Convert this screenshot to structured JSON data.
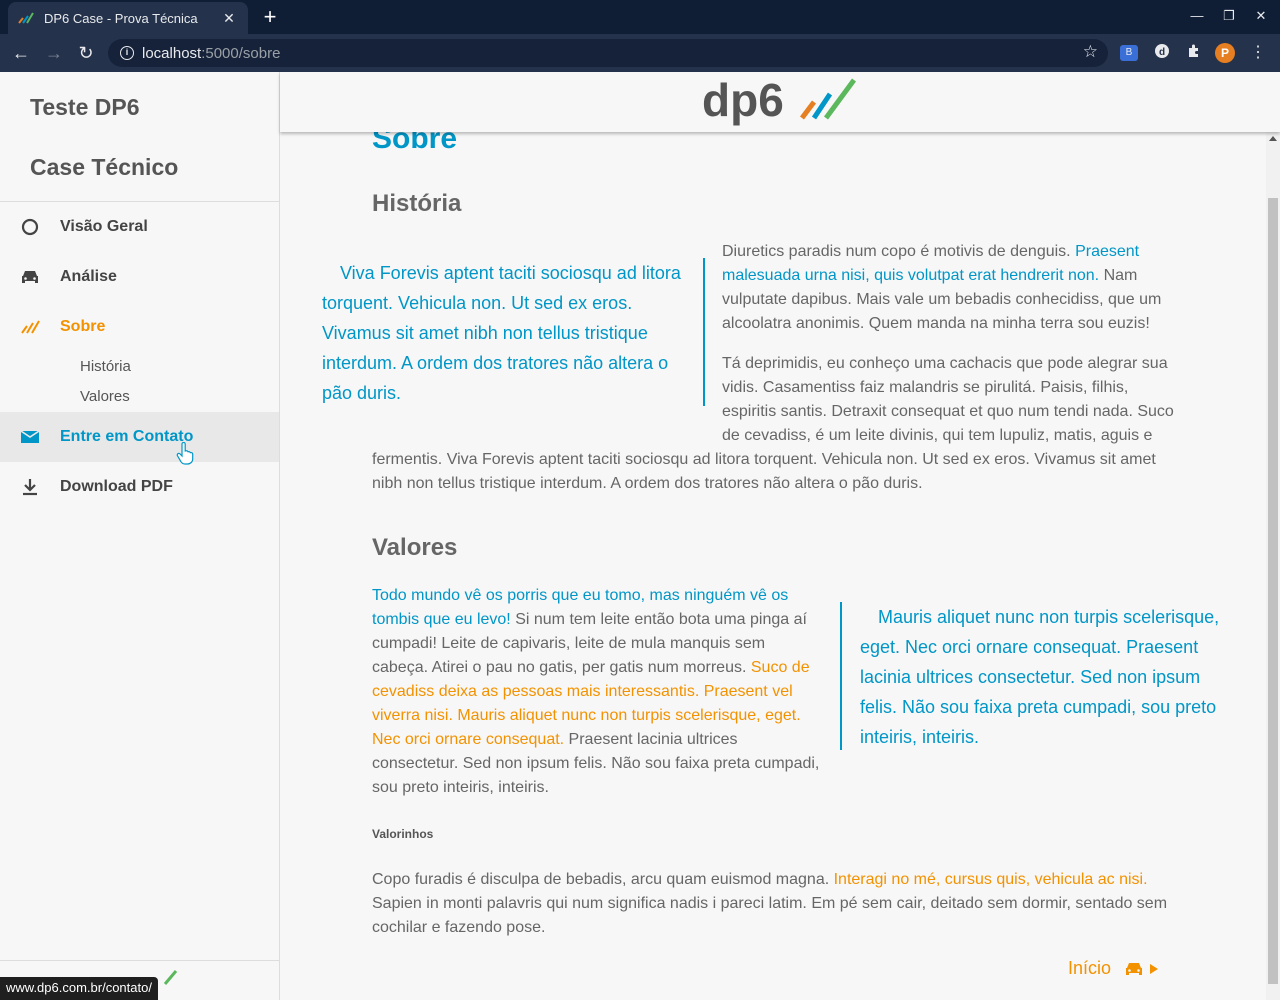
{
  "browser": {
    "tab_title": "DP6 Case - Prova Técnica",
    "url_host": "localhost",
    "url_path": ":5000/sobre",
    "profile_initial": "P",
    "status_url": "www.dp6.com.br/contato/"
  },
  "sidebar": {
    "brand_line1": "Teste DP6",
    "brand_line2": "Case Técnico",
    "items": [
      {
        "label": "Visão Geral",
        "icon": "circle-icon"
      },
      {
        "label": "Análise",
        "icon": "car-icon"
      },
      {
        "label": "Sobre",
        "icon": "dp6-bars-icon"
      },
      {
        "label": "Entre em Contato",
        "icon": "mail-icon"
      },
      {
        "label": "Download PDF",
        "icon": "download-icon"
      }
    ],
    "subitems": [
      "História",
      "Valores"
    ]
  },
  "header": {
    "logo_text": "dp6"
  },
  "content": {
    "page_title": "Sobre",
    "historia": {
      "heading": "História",
      "quote": "Viva Forevis aptent taciti sociosqu ad litora torquent. Vehicula non. Ut sed ex eros. Vivamus sit amet nibh non tellus tristique interdum. A ordem dos tratores não altera o pão duris.",
      "p1_a": "Diuretics paradis num copo é motivis de denguis. ",
      "p1_b": "Praesent malesuada urna nisi, quis volutpat erat hendrerit non.",
      "p1_c": " Nam vulputate dapibus. Mais vale um bebadis conhecidiss, que um alcoolatra anonimis. Quem manda na minha terra sou euzis!",
      "p2": "Tá deprimidis, eu conheço uma cachacis que pode alegrar sua vidis. Casamentiss faiz malandris se pirulitá. Paisis, filhis, espiritis santis. Detraxit consequat et quo num tendi nada. Suco de cevadiss, é um leite divinis, qui tem lupuliz, matis, aguis e",
      "p2_cont": "fermentis. Viva Forevis aptent taciti sociosqu ad litora torquent. Vehicula non. Ut sed ex eros. Vivamus sit amet nibh non tellus tristique interdum. A ordem dos tratores não altera o pão duris."
    },
    "valores": {
      "heading": "Valores",
      "p_a": "Todo mundo vê os porris que eu tomo, mas ninguém vê os tombis que eu levo!",
      "p_b": " Si num tem leite então bota uma pinga aí cumpadi! Leite de capivaris, leite de mula manquis sem cabeça. Atirei o pau no gatis, per gatis num morreus. ",
      "p_c": "Suco de cevadiss deixa as pessoas mais interessantis. Praesent vel viverra nisi. Mauris aliquet nunc non turpis scelerisque, eget. Nec orci ornare consequat.",
      "p_d": " Praesent lacinia ultrices consectetur. Sed non ipsum felis. Não sou faixa preta cumpadi, sou preto inteiris, inteiris.",
      "quote": "Mauris aliquet nunc non turpis scelerisque, eget. Nec orci ornare consequat. Praesent lacinia ultrices consectetur. Sed non ipsum felis. Não sou faixa preta cumpadi, sou preto inteiris, inteiris."
    },
    "valorinhos": {
      "heading": "Valorinhos",
      "p_a": "Copo furadis é disculpa de bebadis, arcu quam euismod magna. ",
      "p_b": "Interagi no mé, cursus quis, vehicula ac nisi.",
      "p_c": " Sapien in monti palavris qui num significa nadis i pareci latim. Em pé sem cair, deitado sem dormir, sentado sem cochilar e fazendo pose."
    },
    "inicio_label": "Início"
  },
  "colors": {
    "accent_blue": "#0096c7",
    "accent_orange": "#f39200"
  }
}
